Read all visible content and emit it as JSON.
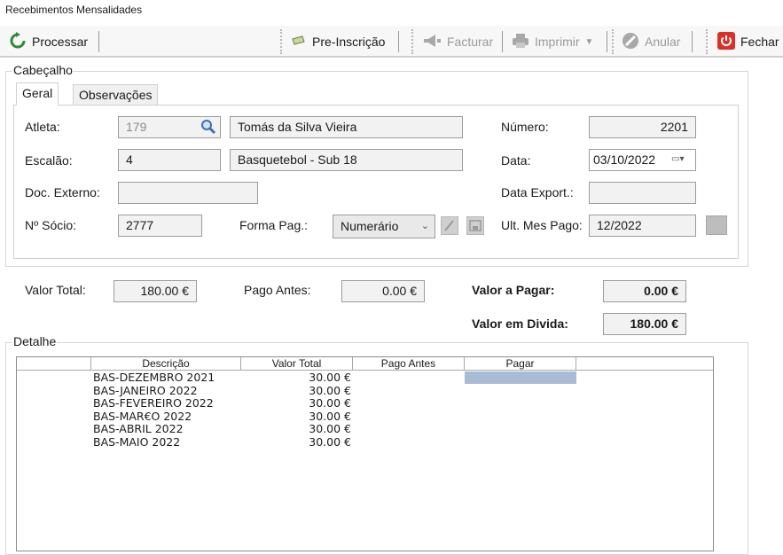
{
  "window": {
    "title": "Recebimentos Mensalidades"
  },
  "toolbar": {
    "processar": "Processar",
    "pre_inscricao": "Pre-Inscrição",
    "facturar": "Facturar",
    "imprimir": "Imprimir",
    "anular": "Anular",
    "fechar": "Fechar"
  },
  "cabecalho": {
    "label": "Cabeçalho",
    "tabs": [
      {
        "label": "Geral"
      },
      {
        "label": "Observações"
      }
    ],
    "atleta_label": "Atleta:",
    "atleta_id": "179",
    "atleta_nome": "Tomás da Silva Vieira",
    "numero_label": "Número:",
    "numero": "2201",
    "escalao_label": "Escalão:",
    "escalao_id": "4",
    "escalao_nome": "Basquetebol - Sub 18",
    "data_label": "Data:",
    "data": "03/10/2022",
    "doc_externo_label": "Doc. Externo:",
    "doc_externo": "",
    "data_export_label": "Data Export.:",
    "data_export": "",
    "socio_label": "Nº Sócio:",
    "socio": "2777",
    "forma_pag_label": "Forma Pag.:",
    "forma_pag": "Numerário",
    "ult_mes_label": "Ult. Mes Pago:",
    "ult_mes": "12/2022"
  },
  "totais": {
    "valor_total_label": "Valor Total:",
    "valor_total": "180.00 €",
    "pago_antes_label": "Pago Antes:",
    "pago_antes": "0.00 €",
    "valor_pagar_label": "Valor a Pagar:",
    "valor_pagar": "0.00 €",
    "valor_divida_label": "Valor em Divida:",
    "valor_divida": "180.00 €"
  },
  "detalhe": {
    "label": "Detalhe",
    "columns": [
      "Descrição",
      "Valor Total",
      "Pago Antes",
      "Pagar"
    ],
    "rows": [
      {
        "descricao": "BAS-DEZEMBRO 2021",
        "valor_total": "30.00 €"
      },
      {
        "descricao": "BAS-JANEIRO 2022",
        "valor_total": "30.00 €"
      },
      {
        "descricao": "BAS-FEVEREIRO 2022",
        "valor_total": "30.00 €"
      },
      {
        "descricao": "BAS-MAR€O 2022",
        "valor_total": "30.00 €"
      },
      {
        "descricao": "BAS-ABRIL 2022",
        "valor_total": "30.00 €"
      },
      {
        "descricao": "BAS-MAIO 2022",
        "valor_total": "30.00 €"
      }
    ]
  },
  "colors": {
    "selected_cell": "#a9bcd6",
    "fechar_icon": "#d9302a",
    "processar_icon": "#2e8b3a"
  }
}
